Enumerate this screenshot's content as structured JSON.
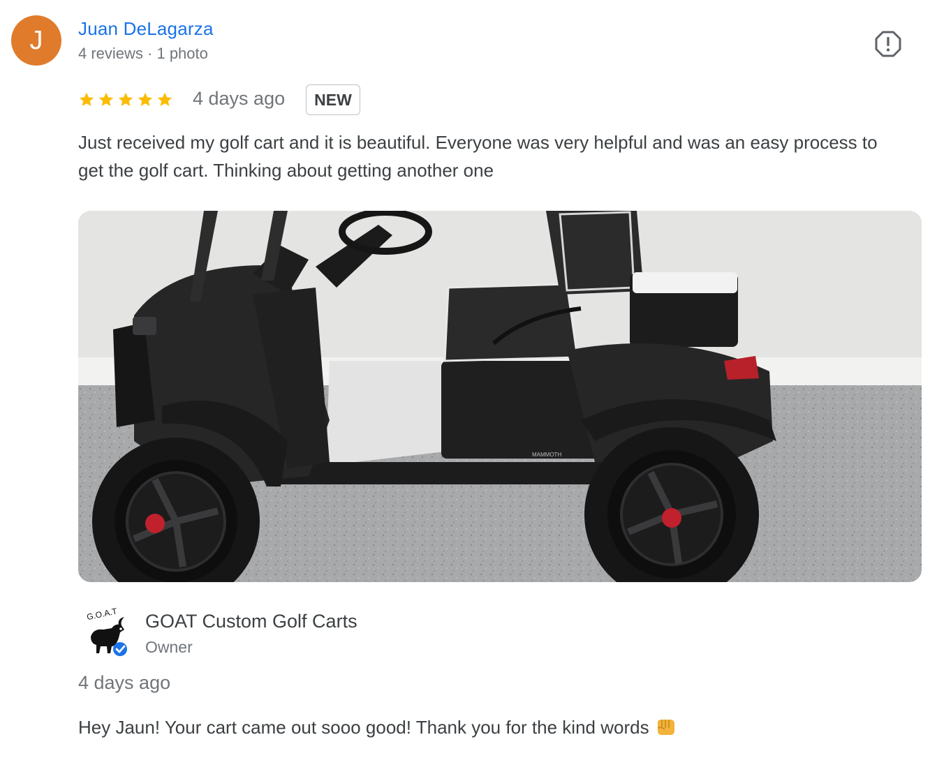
{
  "reviewer": {
    "initial": "J",
    "name": "Juan DeLagarza",
    "meta": "4 reviews · 1 photo",
    "avatar_color": "#e07b2b"
  },
  "review": {
    "rating": 5,
    "max_rating": 5,
    "date": "4 days ago",
    "badge": "NEW",
    "text": "Just received my golf cart and it is beautiful. Everyone was very helpful and was an easy process to get the golf cart. Thinking about getting another one"
  },
  "photo": {
    "wheel_logo_text": "MAMMOTH"
  },
  "owner_response": {
    "business_name": "GOAT Custom Golf Carts",
    "role": "Owner",
    "date": "4 days ago",
    "text": "Hey Jaun! Your cart came out sooo good! Thank you for the kind words",
    "emoji": "oncoming-fist-icon",
    "logo_text": "G.O.A.T"
  },
  "colors": {
    "link": "#1a73e8",
    "star": "#fbbc04",
    "verified": "#1a73e8",
    "text": "#3c4043",
    "secondary": "#70757a"
  }
}
